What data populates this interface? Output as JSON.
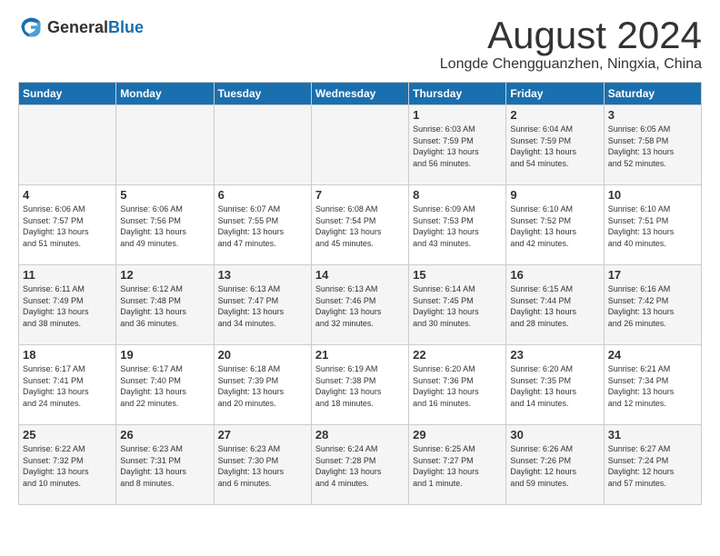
{
  "logo": {
    "general": "General",
    "blue": "Blue"
  },
  "header": {
    "month": "August 2024",
    "location": "Longde Chengguanzhen, Ningxia, China"
  },
  "days_of_week": [
    "Sunday",
    "Monday",
    "Tuesday",
    "Wednesday",
    "Thursday",
    "Friday",
    "Saturday"
  ],
  "weeks": [
    [
      {
        "day": "",
        "info": ""
      },
      {
        "day": "",
        "info": ""
      },
      {
        "day": "",
        "info": ""
      },
      {
        "day": "",
        "info": ""
      },
      {
        "day": "1",
        "info": "Sunrise: 6:03 AM\nSunset: 7:59 PM\nDaylight: 13 hours\nand 56 minutes."
      },
      {
        "day": "2",
        "info": "Sunrise: 6:04 AM\nSunset: 7:59 PM\nDaylight: 13 hours\nand 54 minutes."
      },
      {
        "day": "3",
        "info": "Sunrise: 6:05 AM\nSunset: 7:58 PM\nDaylight: 13 hours\nand 52 minutes."
      }
    ],
    [
      {
        "day": "4",
        "info": "Sunrise: 6:06 AM\nSunset: 7:57 PM\nDaylight: 13 hours\nand 51 minutes."
      },
      {
        "day": "5",
        "info": "Sunrise: 6:06 AM\nSunset: 7:56 PM\nDaylight: 13 hours\nand 49 minutes."
      },
      {
        "day": "6",
        "info": "Sunrise: 6:07 AM\nSunset: 7:55 PM\nDaylight: 13 hours\nand 47 minutes."
      },
      {
        "day": "7",
        "info": "Sunrise: 6:08 AM\nSunset: 7:54 PM\nDaylight: 13 hours\nand 45 minutes."
      },
      {
        "day": "8",
        "info": "Sunrise: 6:09 AM\nSunset: 7:53 PM\nDaylight: 13 hours\nand 43 minutes."
      },
      {
        "day": "9",
        "info": "Sunrise: 6:10 AM\nSunset: 7:52 PM\nDaylight: 13 hours\nand 42 minutes."
      },
      {
        "day": "10",
        "info": "Sunrise: 6:10 AM\nSunset: 7:51 PM\nDaylight: 13 hours\nand 40 minutes."
      }
    ],
    [
      {
        "day": "11",
        "info": "Sunrise: 6:11 AM\nSunset: 7:49 PM\nDaylight: 13 hours\nand 38 minutes."
      },
      {
        "day": "12",
        "info": "Sunrise: 6:12 AM\nSunset: 7:48 PM\nDaylight: 13 hours\nand 36 minutes."
      },
      {
        "day": "13",
        "info": "Sunrise: 6:13 AM\nSunset: 7:47 PM\nDaylight: 13 hours\nand 34 minutes."
      },
      {
        "day": "14",
        "info": "Sunrise: 6:13 AM\nSunset: 7:46 PM\nDaylight: 13 hours\nand 32 minutes."
      },
      {
        "day": "15",
        "info": "Sunrise: 6:14 AM\nSunset: 7:45 PM\nDaylight: 13 hours\nand 30 minutes."
      },
      {
        "day": "16",
        "info": "Sunrise: 6:15 AM\nSunset: 7:44 PM\nDaylight: 13 hours\nand 28 minutes."
      },
      {
        "day": "17",
        "info": "Sunrise: 6:16 AM\nSunset: 7:42 PM\nDaylight: 13 hours\nand 26 minutes."
      }
    ],
    [
      {
        "day": "18",
        "info": "Sunrise: 6:17 AM\nSunset: 7:41 PM\nDaylight: 13 hours\nand 24 minutes."
      },
      {
        "day": "19",
        "info": "Sunrise: 6:17 AM\nSunset: 7:40 PM\nDaylight: 13 hours\nand 22 minutes."
      },
      {
        "day": "20",
        "info": "Sunrise: 6:18 AM\nSunset: 7:39 PM\nDaylight: 13 hours\nand 20 minutes."
      },
      {
        "day": "21",
        "info": "Sunrise: 6:19 AM\nSunset: 7:38 PM\nDaylight: 13 hours\nand 18 minutes."
      },
      {
        "day": "22",
        "info": "Sunrise: 6:20 AM\nSunset: 7:36 PM\nDaylight: 13 hours\nand 16 minutes."
      },
      {
        "day": "23",
        "info": "Sunrise: 6:20 AM\nSunset: 7:35 PM\nDaylight: 13 hours\nand 14 minutes."
      },
      {
        "day": "24",
        "info": "Sunrise: 6:21 AM\nSunset: 7:34 PM\nDaylight: 13 hours\nand 12 minutes."
      }
    ],
    [
      {
        "day": "25",
        "info": "Sunrise: 6:22 AM\nSunset: 7:32 PM\nDaylight: 13 hours\nand 10 minutes."
      },
      {
        "day": "26",
        "info": "Sunrise: 6:23 AM\nSunset: 7:31 PM\nDaylight: 13 hours\nand 8 minutes."
      },
      {
        "day": "27",
        "info": "Sunrise: 6:23 AM\nSunset: 7:30 PM\nDaylight: 13 hours\nand 6 minutes."
      },
      {
        "day": "28",
        "info": "Sunrise: 6:24 AM\nSunset: 7:28 PM\nDaylight: 13 hours\nand 4 minutes."
      },
      {
        "day": "29",
        "info": "Sunrise: 6:25 AM\nSunset: 7:27 PM\nDaylight: 13 hours\nand 1 minute."
      },
      {
        "day": "30",
        "info": "Sunrise: 6:26 AM\nSunset: 7:26 PM\nDaylight: 12 hours\nand 59 minutes."
      },
      {
        "day": "31",
        "info": "Sunrise: 6:27 AM\nSunset: 7:24 PM\nDaylight: 12 hours\nand 57 minutes."
      }
    ]
  ]
}
